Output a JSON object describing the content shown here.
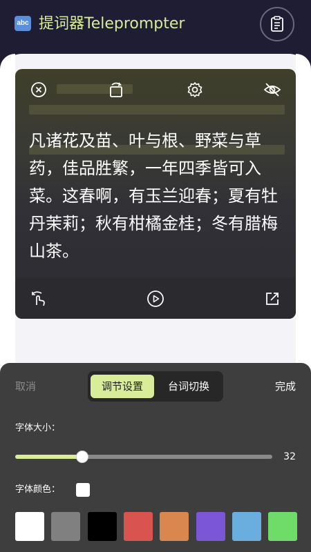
{
  "header": {
    "badge_text": "abc",
    "title": "提词器Teleprompter",
    "clipboard_icon": "clipboard-icon"
  },
  "prompter": {
    "top_icons": [
      "close-circle-icon",
      "rotate-icon",
      "gear-icon",
      "eye-off-icon"
    ],
    "text": "凡诸花及苗、叶与根、野菜与草药，佳品胜繁，一年四季皆可入菜。这春啊，有玉兰迎春；夏有牡丹茉莉；秋有柑橘金桂；冬有腊梅山茶。",
    "bottom_icons": [
      "touch-swipe-icon",
      "play-circle-icon",
      "external-link-icon"
    ]
  },
  "sheet": {
    "cancel_label": "取消",
    "done_label": "完成",
    "tabs": [
      {
        "label": "调节设置",
        "active": true
      },
      {
        "label": "台词切换",
        "active": false
      }
    ],
    "font_size_label": "字体大小：",
    "font_size_value": "32",
    "font_size_fraction": 0.26,
    "font_color_label": "字体颜色：",
    "font_color_current": "#ffffff",
    "swatches": [
      "#ffffff",
      "#808080",
      "#000000",
      "#d9534f",
      "#d9874f",
      "#7b56d6",
      "#6aaee0",
      "#6fdc6a"
    ]
  },
  "colors": {
    "accent": "#d9ec9a",
    "header_bg": "#1f1d33",
    "sheet_bg": "#3e3e3e"
  }
}
